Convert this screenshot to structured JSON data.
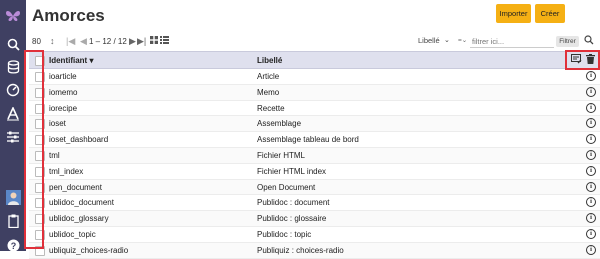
{
  "sidebar": {
    "items": [
      {
        "icon": "butterfly-logo-icon"
      },
      {
        "icon": "search-icon"
      },
      {
        "icon": "database-icon"
      },
      {
        "icon": "dashboard-gauge-icon"
      },
      {
        "icon": "typography-icon"
      },
      {
        "icon": "sliders-icon"
      },
      {
        "icon": "avatar"
      },
      {
        "icon": "clipboard-icon"
      },
      {
        "icon": "help-icon"
      }
    ]
  },
  "header": {
    "title": "Amorces",
    "import_label": "Importer",
    "create_label": "Créer"
  },
  "toolbar": {
    "page_size": "80",
    "range": "1 – 12 / 12",
    "sort_field": "Libellé",
    "filter_placeholder": "filtrer ici...",
    "filter_label": "Filtrer"
  },
  "table": {
    "headers": {
      "id": "Identifiant",
      "label": "Libellé"
    },
    "rows": [
      {
        "id": "ioarticle",
        "label": "Article"
      },
      {
        "id": "iomemo",
        "label": "Memo"
      },
      {
        "id": "iorecipe",
        "label": "Recette"
      },
      {
        "id": "ioset",
        "label": "Assemblage"
      },
      {
        "id": "ioset_dashboard",
        "label": "Assemblage tableau de bord"
      },
      {
        "id": "tml",
        "label": "Fichier HTML"
      },
      {
        "id": "tml_index",
        "label": "Fichier HTML index"
      },
      {
        "id": "pen_document",
        "label": "Open Document"
      },
      {
        "id": "ublidoc_document",
        "label": "Publidoc : document"
      },
      {
        "id": "ublidoc_glossary",
        "label": "Publidoc : glossaire"
      },
      {
        "id": "ublidoc_topic",
        "label": "Publidoc : topic"
      },
      {
        "id": "ubliquiz_choices-radio",
        "label": "Publiquiz : choices-radio"
      }
    ]
  },
  "colors": {
    "sidebar": "#3f4062",
    "accent": "#f5b014",
    "header_row": "#dfe0ee",
    "highlight": "#e0303a"
  }
}
